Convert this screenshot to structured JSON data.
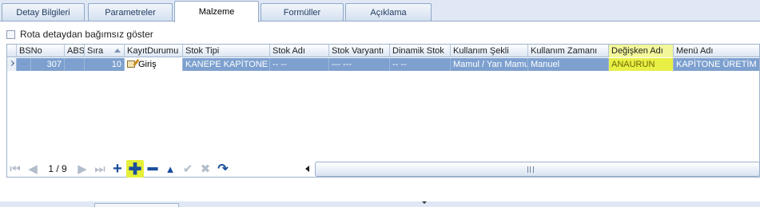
{
  "tabs": [
    {
      "label": "Detay Bilgileri"
    },
    {
      "label": "Parametreler"
    },
    {
      "label": "Malzeme"
    },
    {
      "label": "Formüller"
    },
    {
      "label": "Açıklama"
    }
  ],
  "active_tab": "Malzeme",
  "checkbox": {
    "label": "Rota detaydan bağımsız göster",
    "checked": false
  },
  "grid": {
    "columns": [
      "BSNo",
      "ABSN",
      "Sıra",
      "KayıtDurumu",
      "Stok Tipi",
      "Stok Adı",
      "Stok Varyantı",
      "Dinamik Stok",
      "Kullanım Şekli",
      "Kullanım Zamanı",
      "Değişken Adı",
      "Menü Adı"
    ],
    "sorted_column": "Sıra",
    "highlighted_column": "Değişken Adı",
    "rows": [
      {
        "bsno": "307",
        "absn": "",
        "sira": "10",
        "kayit_durumu": "Giriş",
        "stok_tipi": "KANEPE KAPİTONE",
        "stok_adi": "-- --",
        "stok_varyanti": "--- ---",
        "dinamik_stok": "-- --",
        "kullanim_sekli": "Mamul / Yarı Mamul",
        "kullanim_zamani": "Manuel",
        "degisken_adi": "ANAURUN",
        "menu_adi": "KAPİTONE ÜRETİM"
      }
    ]
  },
  "navigator": {
    "page_text": "1 / 9",
    "icons": [
      "first-icon",
      "prev-icon",
      "next-icon",
      "last-icon",
      "add-icon",
      "add-child-icon",
      "remove-icon",
      "up-icon",
      "check-icon",
      "cancel-icon",
      "refresh-icon"
    ],
    "highlight_color": "#e6ef38"
  },
  "colors": {
    "selected_row": "#7da0cf",
    "highlight": "#e8ef45",
    "accent": "#1b4f9c"
  }
}
